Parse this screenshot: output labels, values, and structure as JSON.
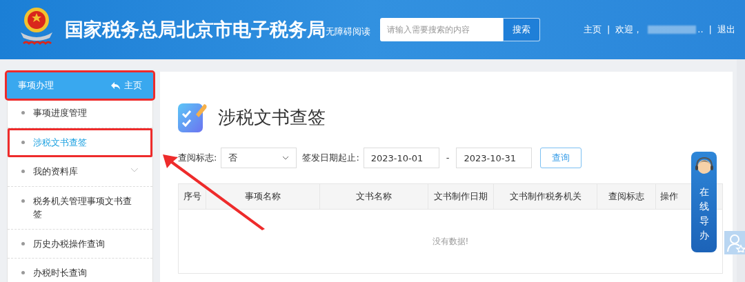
{
  "header": {
    "title": "国家税务总局北京市电子税务局",
    "accessibility_link": "无障碍阅读",
    "search": {
      "placeholder": "请输入需要搜索的内容",
      "button": "搜索"
    },
    "nav": {
      "home": "主页",
      "separator_1": "|",
      "welcome": "欢迎，",
      "ellipsis": "..",
      "separator_2": "|",
      "logout": "退出"
    }
  },
  "sidebar": {
    "header": {
      "label": "事项办理",
      "home_link": "主页",
      "highlighted": true
    },
    "items": [
      {
        "label": "事项进度管理",
        "selected": false,
        "expandable": false,
        "highlighted": false
      },
      {
        "label": "涉税文书查签",
        "selected": true,
        "expandable": false,
        "highlighted": true
      },
      {
        "label": "我的资料库",
        "selected": false,
        "expandable": true,
        "highlighted": false
      },
      {
        "label": "税务机关管理事项文书查签",
        "selected": false,
        "expandable": false,
        "highlighted": false
      },
      {
        "label": "历史办税操作查询",
        "selected": false,
        "expandable": false,
        "highlighted": false
      },
      {
        "label": "办税时长查询",
        "selected": false,
        "expandable": false,
        "highlighted": false
      }
    ]
  },
  "page": {
    "title": "涉税文书查签",
    "filters": {
      "read_flag_label": "查阅标志:",
      "read_flag_value": "否",
      "date_label": "签发日期起止:",
      "date_from": "2023-10-01",
      "date_separator": "-",
      "date_to": "2023-10-31",
      "query_button": "查询"
    },
    "table": {
      "columns": [
        "序号",
        "事项名称",
        "文书名称",
        "文书制作日期",
        "文书制作税务机关",
        "查阅标志",
        "操作"
      ],
      "empty_text": "没有数据!"
    }
  },
  "online_help": {
    "label": "在线导办"
  }
}
